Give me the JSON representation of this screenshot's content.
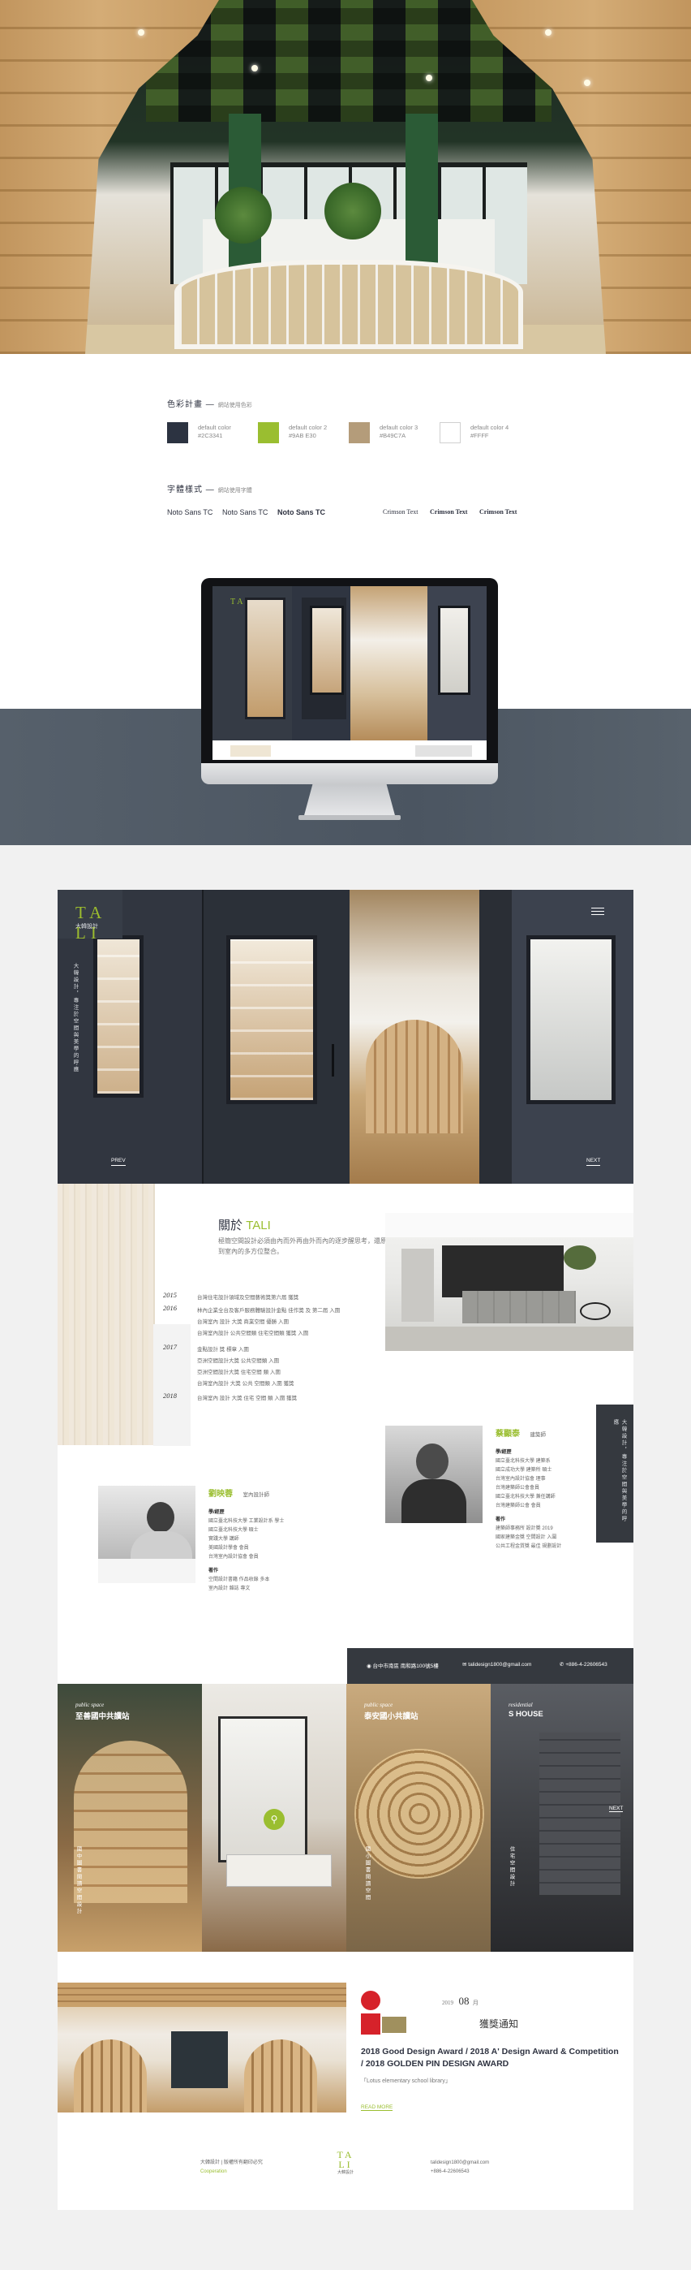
{
  "style_guide": {
    "colors_title": "色彩計畫",
    "colors_subtitle": "網站使用色彩",
    "colors": [
      {
        "name": "default color",
        "hex": "#2C3341"
      },
      {
        "name": "default color 2",
        "hex": "#9AB E30"
      },
      {
        "name": "default color 3",
        "hex": "#B49C7A"
      },
      {
        "name": "default color 4",
        "hex": "#FFFF"
      }
    ],
    "fonts_title": "字體樣式",
    "fonts_subtitle": "網站使用字體",
    "fonts": [
      "Noto Sans TC",
      "Noto Sans TC",
      "Noto Sans TC",
      "Crimson Text",
      "Crimson Text",
      "Crimson Text"
    ]
  },
  "site": {
    "logo_text": "TA LI",
    "logo_sub": "大韓設計",
    "hero_vertical": "大韓設計，專注於空間與美學的呼應",
    "prev_label": "PREV",
    "next_label": "NEXT",
    "about": {
      "title_prefix": "關於",
      "title_accent": "TALI",
      "intro": "極簡空間設計必須由內而外再由外而內的逐步醒思考，還原到室內的多方位整合。",
      "timeline": [
        {
          "year": "2015",
          "items": [
            "台灣住宅設計領域及空間藝術獎第六屆 獲獎"
          ]
        },
        {
          "year": "2016",
          "items": [
            "林內企業全台及客戶服務體驗設計金點 佳作獎 及 第二屆 入圍",
            "台灣室內 設計 大獎 商業空間 優勝 入圍",
            "台灣室內設計 公共空間類 住宅空間類 獲獎 入圍"
          ]
        },
        {
          "year": "2017",
          "items": [
            "金點設計 獎 標章 入圍",
            "亞洲空間設計大獎 公共空間類 入圍",
            "亞洲空間設計大獎 住宅空間 類 入圍",
            "台灣室內設計 大獎 公共 空間類 入圍 獲獎"
          ]
        },
        {
          "year": "2018",
          "items": [
            "台灣室內 設計 大獎 住宅 空間 類 入圍 獲獎"
          ]
        }
      ],
      "people": [
        {
          "name": "蔡顯泰",
          "role": "建築師",
          "sections": [
            {
              "head": "學/經歷",
              "lines": [
                "國立臺北科技大學 建築系",
                "國立成功大學 建築所 碩士",
                "台灣室內設計協會 理事",
                "台灣建築師公會會員",
                "國立臺北科技大學 兼任講師",
                "台灣建築師公會 會員"
              ]
            },
            {
              "head": "著作",
              "lines": [
                "建築師事務所 設計獎 2019",
                "國家建築金獎 空間設計 入圍",
                "公共工程金質獎 最佳 規劃設計"
              ]
            }
          ]
        },
        {
          "name": "劉映蓉",
          "role": "室內設計師",
          "sections": [
            {
              "head": "學/經歷",
              "lines": [
                "國立臺北科技大學 工業設計系 學士",
                "國立臺北科技大學 碩士",
                "實踐大學 講師",
                "美國設計學會 會員",
                "台灣室內設計協會 會員"
              ]
            },
            {
              "head": "著作",
              "lines": [
                "空間設計書籍 作品收錄 多本",
                "室內設計 雜誌 專文"
              ]
            }
          ]
        }
      ],
      "side_vertical": "大韓設計，專注於空間與美學的呼應"
    },
    "contact": {
      "address": "台中市南區 南和路100號5樓",
      "email": "talidesign1800@gmail.com",
      "phone": "+886-4-22606543"
    },
    "projects": [
      {
        "type": "public space",
        "title": "至善國中共讀站",
        "vertical": "國中圖書閱讀空間設計"
      },
      {
        "type": "public space",
        "title": "泰安國小共讀站",
        "vertical": "國小圖書閱讀空間"
      },
      {
        "type": "residential",
        "title": "S HOUSE",
        "vertical": "住宅空間設計"
      }
    ],
    "news": {
      "year": "2019",
      "month": "08",
      "month_suffix": "月",
      "label": "獲獎通知",
      "headline": "2018 Good Design Award / 2018 A' Design Award & Competition / 2018 GOLDEN PIN DESIGN AWARD",
      "sub": "「Lotus elementary school library」",
      "more": "READ MORE"
    },
    "footer": {
      "left_line1": "大韓設計 | 版權所有翻印必究",
      "left_link": "Cooperation",
      "logo": "TA LI",
      "logo_sub": "大韓設計",
      "right_line1": "talidesign1800@gmail.com",
      "right_line2": "+886-4-22606543"
    }
  },
  "theme": {
    "dark": "#2C3341",
    "green": "#9ABE30",
    "tan": "#B49C7A"
  }
}
